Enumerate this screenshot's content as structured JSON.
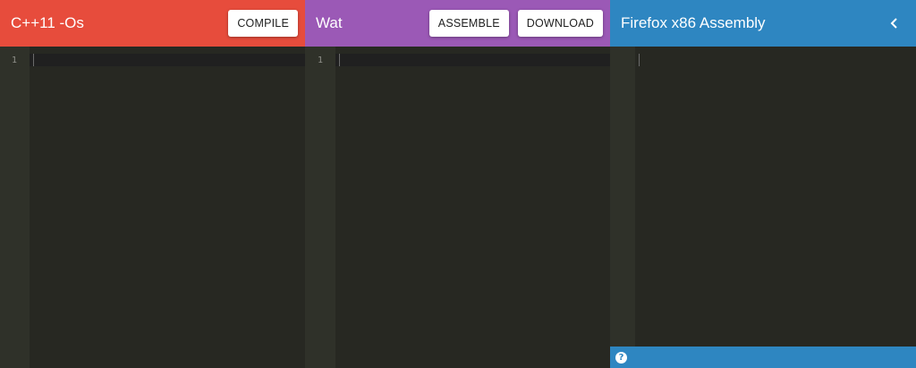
{
  "colors": {
    "pane1_header": "#e74c3c",
    "pane2_header": "#9b59b6",
    "pane3_header": "#2e86c1",
    "editor_bg": "#272822",
    "gutter_bg": "#2f3129"
  },
  "panes": [
    {
      "title": "C++11 -Os",
      "buttons": [
        {
          "label": "COMPILE"
        }
      ],
      "line_numbers": [
        "1"
      ]
    },
    {
      "title": "Wat",
      "buttons": [
        {
          "label": "ASSEMBLE"
        },
        {
          "label": "DOWNLOAD"
        }
      ],
      "line_numbers": [
        "1"
      ]
    },
    {
      "title": "Firefox x86 Assembly",
      "collapse_icon": "chevron-left-icon",
      "status_icon": "help-icon",
      "help_glyph": "?"
    }
  ]
}
